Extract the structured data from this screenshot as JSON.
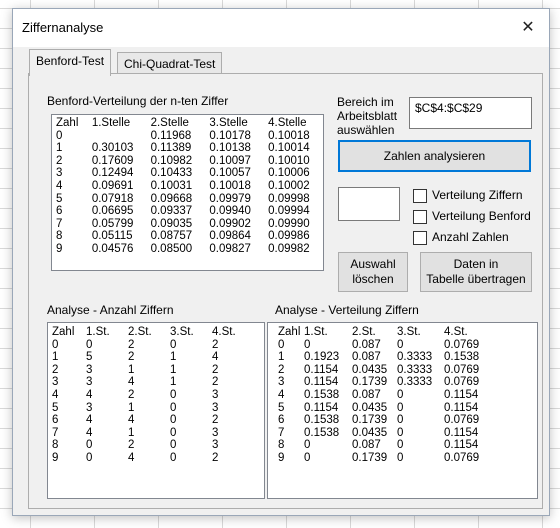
{
  "window": {
    "title": "Ziffernanalyse",
    "close_glyph": "✕"
  },
  "tabs": [
    {
      "label": "Benford-Test",
      "active": true
    },
    {
      "label": "Chi-Quadrat-Test",
      "active": false
    }
  ],
  "benford": {
    "label": "Benford-Verteilung der n-ten Ziffer",
    "headers": [
      "Zahl",
      "1.Stelle",
      "2.Stelle",
      "3.Stelle",
      "4.Stelle"
    ],
    "rows": [
      [
        "0",
        "",
        "0.11968",
        "0.10178",
        "0.10018"
      ],
      [
        "1",
        "0.30103",
        "0.11389",
        "0.10138",
        "0.10014"
      ],
      [
        "2",
        "0.17609",
        "0.10982",
        "0.10097",
        "0.10010"
      ],
      [
        "3",
        "0.12494",
        "0.10433",
        "0.10057",
        "0.10006"
      ],
      [
        "4",
        "0.09691",
        "0.10031",
        "0.10018",
        "0.10002"
      ],
      [
        "5",
        "0.07918",
        "0.09668",
        "0.09979",
        "0.09998"
      ],
      [
        "6",
        "0.06695",
        "0.09337",
        "0.09940",
        "0.09994"
      ],
      [
        "7",
        "0.05799",
        "0.09035",
        "0.09902",
        "0.09990"
      ],
      [
        "8",
        "0.05115",
        "0.08757",
        "0.09864",
        "0.09986"
      ],
      [
        "9",
        "0.04576",
        "0.08500",
        "0.09827",
        "0.09982"
      ]
    ]
  },
  "range": {
    "label_lines": [
      "Bereich im",
      "Arbeitsblatt",
      "auswählen"
    ],
    "value": "$C$4:$C$29"
  },
  "buttons": {
    "analyze": "Zahlen analysieren",
    "clear_lines": [
      "Auswahl",
      "löschen"
    ],
    "transfer_lines": [
      "Daten in",
      "Tabelle übertragen"
    ]
  },
  "small_input": {
    "value": ""
  },
  "checkboxes": [
    {
      "label": "Verteilung Ziffern",
      "checked": false
    },
    {
      "label": "Verteilung Benford",
      "checked": false
    },
    {
      "label": "Anzahl Zahlen",
      "checked": false
    }
  ],
  "count": {
    "label": "Analyse - Anzahl Ziffern",
    "headers": [
      "Zahl",
      "1.St.",
      "2.St.",
      "3.St.",
      "4.St."
    ],
    "rows": [
      [
        "0",
        "0",
        "2",
        "0",
        "2"
      ],
      [
        "1",
        "5",
        "2",
        "1",
        "4"
      ],
      [
        "2",
        "3",
        "1",
        "1",
        "2"
      ],
      [
        "3",
        "3",
        "4",
        "1",
        "2"
      ],
      [
        "4",
        "4",
        "2",
        "0",
        "3"
      ],
      [
        "5",
        "3",
        "1",
        "0",
        "3"
      ],
      [
        "6",
        "4",
        "4",
        "0",
        "2"
      ],
      [
        "7",
        "4",
        "1",
        "0",
        "3"
      ],
      [
        "8",
        "0",
        "2",
        "0",
        "3"
      ],
      [
        "9",
        "0",
        "4",
        "0",
        "2"
      ]
    ]
  },
  "distribution": {
    "label": "Analyse - Verteilung Ziffern",
    "headers": [
      "Zahl",
      "1.St.",
      "2.St.",
      "3.St.",
      "4.St."
    ],
    "rows": [
      [
        "0",
        "0",
        "0.087",
        "0",
        "0.0769"
      ],
      [
        "1",
        "0.1923",
        "0.087",
        "0.3333",
        "0.1538"
      ],
      [
        "2",
        "0.1154",
        "0.0435",
        "0.3333",
        "0.0769"
      ],
      [
        "3",
        "0.1154",
        "0.1739",
        "0.3333",
        "0.0769"
      ],
      [
        "4",
        "0.1538",
        "0.087",
        "0",
        "0.1154"
      ],
      [
        "5",
        "0.1154",
        "0.0435",
        "0",
        "0.1154"
      ],
      [
        "6",
        "0.1538",
        "0.1739",
        "0",
        "0.0769"
      ],
      [
        "7",
        "0.1538",
        "0.0435",
        "0",
        "0.1154"
      ],
      [
        "8",
        "0",
        "0.087",
        "0",
        "0.1154"
      ],
      [
        "9",
        "0",
        "0.1739",
        "0",
        "0.0769"
      ]
    ]
  }
}
